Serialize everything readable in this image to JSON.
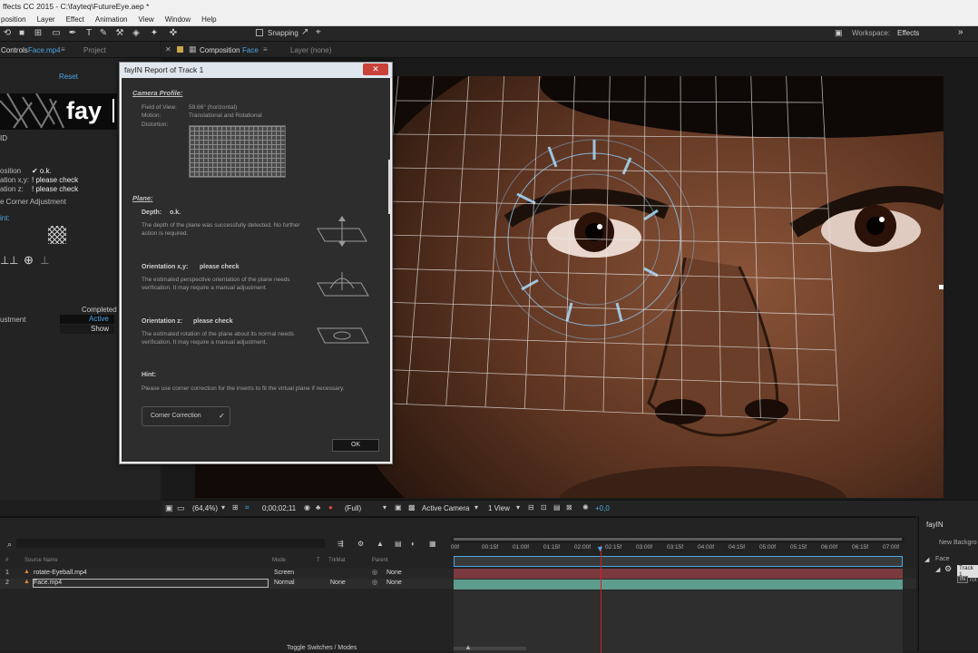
{
  "window": {
    "title": "ffects CC 2015 - C:\\fayteq\\FutureEye.aep *"
  },
  "menu": [
    "position",
    "Layer",
    "Effect",
    "Animation",
    "View",
    "Window",
    "Help"
  ],
  "toolbar": {
    "snapping": "Snapping",
    "workspace_label": "Workspace:",
    "workspace_value": "Effects"
  },
  "left_panel": {
    "tab_controls": "Controls",
    "tab_controls_file": "Face.mp4",
    "tab_project": "Project",
    "reset": "Reset",
    "logo_text": "fay",
    "id_label": "ID",
    "status_rows": [
      {
        "label": "osition",
        "value": "✔ o.k."
      },
      {
        "label": "ation x,y:",
        "value": "! please check"
      },
      {
        "label": "ation z:",
        "value": "! please check"
      }
    ],
    "corner_adjustment": "e Corner Adjustment",
    "hint_label": "int:",
    "completed": "Completed",
    "adjustment": "ustment",
    "active": "Active",
    "show": "Show"
  },
  "comp_tabs": {
    "composition": "Composition",
    "composition_name": "Face",
    "layer": "Layer (none)"
  },
  "dialog": {
    "title": "fayIN Report of Track 1",
    "camera_profile": "Camera Profile:",
    "fov_label": "Field of View:",
    "fov_value": "59.66° (horizontal)",
    "motion_label": "Motion:",
    "motion_value": "Translational and Rotational",
    "distortion_label": "Distortion:",
    "plane": "Plane:",
    "depth_label": "Depth:",
    "depth_value": "o.k.",
    "depth_desc": "The depth of the plane was successfully detected. No further action is required.",
    "orient_xy_label": "Orientation x,y:",
    "orient_xy_value": "please check",
    "orient_xy_desc": "The estimated perspective orientation of the plane needs verification. It may require a manual adjustment.",
    "orient_z_label": "Orientation z:",
    "orient_z_value": "please check",
    "orient_z_desc": "The estimated rotation of the plane about its normal needs verification. It may require a manual adjustment.",
    "hint": "Hint:",
    "hint_text": "Please use corner correction for the inserts to fit the virtual plane if necessary.",
    "corner_button": "Corner Correction",
    "corner_check": "✓",
    "ok": "OK"
  },
  "viewer_footer": {
    "zoom": "(64,4%)",
    "time": "0;00;02;11",
    "resolution": "(Full)",
    "camera": "Active Camera",
    "views": "1 View",
    "exposure": "+0,0"
  },
  "timeline": {
    "col_num": "#",
    "col_source": "Source Name",
    "col_mode": "Mode",
    "col_t": "T",
    "col_trkmat": "TrkMat",
    "col_parent": "Parent",
    "layers": [
      {
        "num": "1",
        "name": "rotate-Eyeball.mp4",
        "mode": "Screen",
        "trkmat": "",
        "parent": "None"
      },
      {
        "num": "2",
        "name": "Face.mp4",
        "mode": "Normal",
        "trkmat": "None",
        "parent": "None"
      }
    ],
    "ruler": [
      "00f",
      "00:15f",
      "01:00f",
      "01:15f",
      "02:00f",
      "02:15f",
      "03:00f",
      "03:15f",
      "04:00f",
      "04:15f",
      "05:00f",
      "05:15f",
      "06:00f",
      "06:15f",
      "07:00f"
    ],
    "toggle": "Toggle Switches / Modes"
  },
  "right_panel": {
    "title": "fayIN",
    "new_bg": "New Backgro",
    "face": "Face",
    "track": "Track 1",
    "in": "IN",
    "rot": "rot"
  },
  "colors": {
    "accent": "#4ba6e6",
    "layer1": "#7a3a3d",
    "layer2": "#5e9c8e",
    "playhead": "#d02020"
  }
}
